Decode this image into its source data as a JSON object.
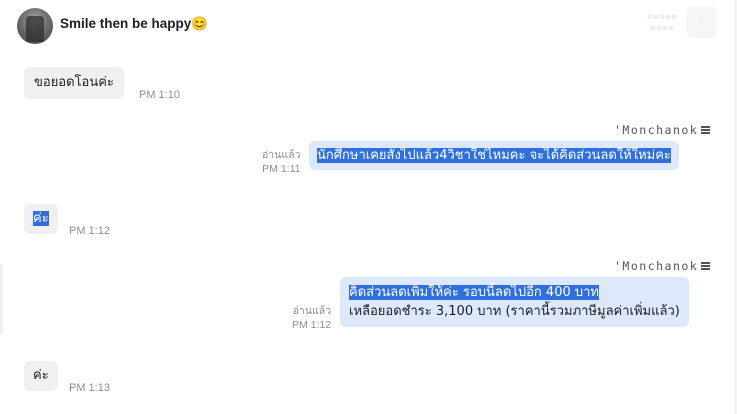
{
  "header": {
    "contact_name": "Smile then be happy😊",
    "menu_icon": "more-options-icon",
    "colors": {
      "header_text": "#1c1e21"
    }
  },
  "colors": {
    "incoming_bubble": "#f0f0f0",
    "outgoing_bubble": "#dde8fb",
    "selection_highlight": "#2f6fe0",
    "timestamp_text": "#8a8d91"
  },
  "messages": [
    {
      "direction": "incoming",
      "text": "ขอยอดโอนค่ะ",
      "time": "PM 1:10"
    },
    {
      "direction": "outgoing",
      "sender": "'Monchanok",
      "read_label": "อ่านแล้ว",
      "time": "PM 1:11",
      "text": "นักศึกษาเคยสั่งไปแล้ว4วิชาใช่ไหมคะ จะได้คิดส่วนลดให้ใหม่คะ"
    },
    {
      "direction": "incoming",
      "text": "ค่ะ",
      "time": "PM 1:12"
    },
    {
      "direction": "outgoing",
      "sender": "'Monchanok",
      "read_label": "อ่านแล้ว",
      "time": "PM 1:12",
      "line1": "คิดส่วนลดเพิ่มให้ค่ะ รอบนี้ลดไปอีก 400 บาท",
      "line2": "เหลือยอดชำระ 3,100 บาท (ราคานี้รวมภาษีมูลค่าเพิ่มแล้ว)"
    },
    {
      "direction": "incoming",
      "text": "ค่ะ",
      "time": "PM 1:13"
    }
  ]
}
